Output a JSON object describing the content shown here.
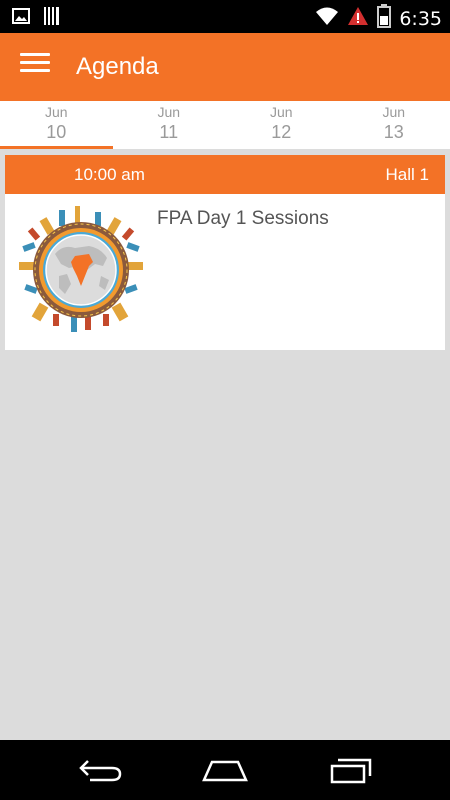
{
  "status_bar": {
    "time": "6:35",
    "icons": [
      "gallery-icon",
      "barcode-icon",
      "wifi-icon",
      "alert-icon",
      "battery-icon"
    ]
  },
  "app_bar": {
    "title": "Agenda",
    "menu_icon": "hamburger-menu-icon"
  },
  "date_tabs": [
    {
      "month": "Jun",
      "day": "10",
      "active": true
    },
    {
      "month": "Jun",
      "day": "11",
      "active": false
    },
    {
      "month": "Jun",
      "day": "12",
      "active": false
    },
    {
      "month": "Jun",
      "day": "13",
      "active": false
    }
  ],
  "session": {
    "time": "10:00 am",
    "hall": "Hall 1",
    "title": "FPA Day 1 Sessions",
    "logo_icon": "india-globe-landmarks-logo"
  },
  "nav_bar": {
    "icons": [
      "back-icon",
      "home-icon",
      "recent-apps-icon"
    ]
  },
  "colors": {
    "accent": "#f37226",
    "background": "#dcdcdc",
    "tab_text": "#9a9a9a",
    "title_text": "#555555"
  }
}
